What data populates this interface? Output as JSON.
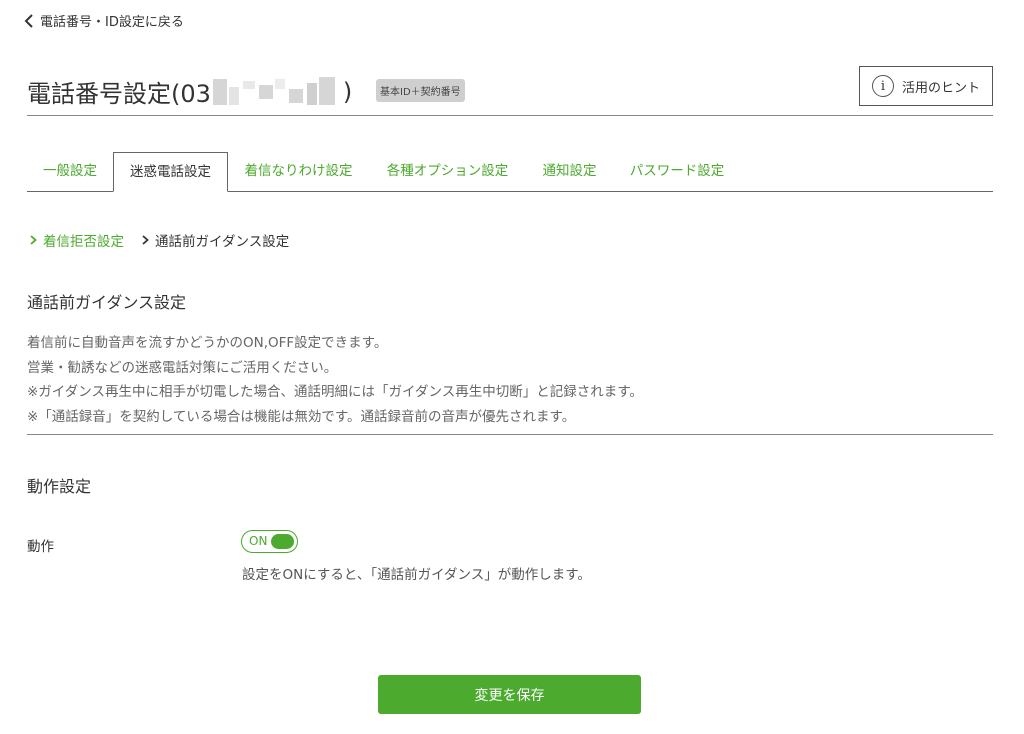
{
  "back": {
    "label": "電話番号・ID設定に戻る"
  },
  "header": {
    "title_prefix": "電話番号設定(03",
    "title_suffix": ")",
    "badge": "基本ID＋契約番号",
    "hint_button": "活用のヒント",
    "hint_icon": "i"
  },
  "tabs": [
    {
      "label": "一般設定",
      "active": false
    },
    {
      "label": "迷惑電話設定",
      "active": true
    },
    {
      "label": "着信なりわけ設定",
      "active": false
    },
    {
      "label": "各種オプション設定",
      "active": false
    },
    {
      "label": "通知設定",
      "active": false
    },
    {
      "label": "パスワード設定",
      "active": false
    }
  ],
  "subnav": [
    {
      "label": "着信拒否設定"
    },
    {
      "label": "通話前ガイダンス設定"
    }
  ],
  "section": {
    "title": "通話前ガイダンス設定",
    "description": [
      "着信前に自動音声を流すかどうかのON,OFF設定できます。",
      "営業・勧誘などの迷惑電話対策にご活用ください。",
      "※ガイダンス再生中に相手が切電した場合、通話明細には「ガイダンス再生中切断」と記録されます。",
      "※「通話録音」を契約している場合は機能は無効です。通話録音前の音声が優先されます。"
    ]
  },
  "operation": {
    "title": "動作設定",
    "label": "動作",
    "toggle_text": "ON",
    "toggle_on": true,
    "note": "設定をONにすると、「通話前ガイダンス」が動作します。"
  },
  "save_button": "変更を保存",
  "colors": {
    "accent": "#4caa2e",
    "text": "#333333",
    "muted": "#666666",
    "badge_bg": "#cfcfcf"
  }
}
